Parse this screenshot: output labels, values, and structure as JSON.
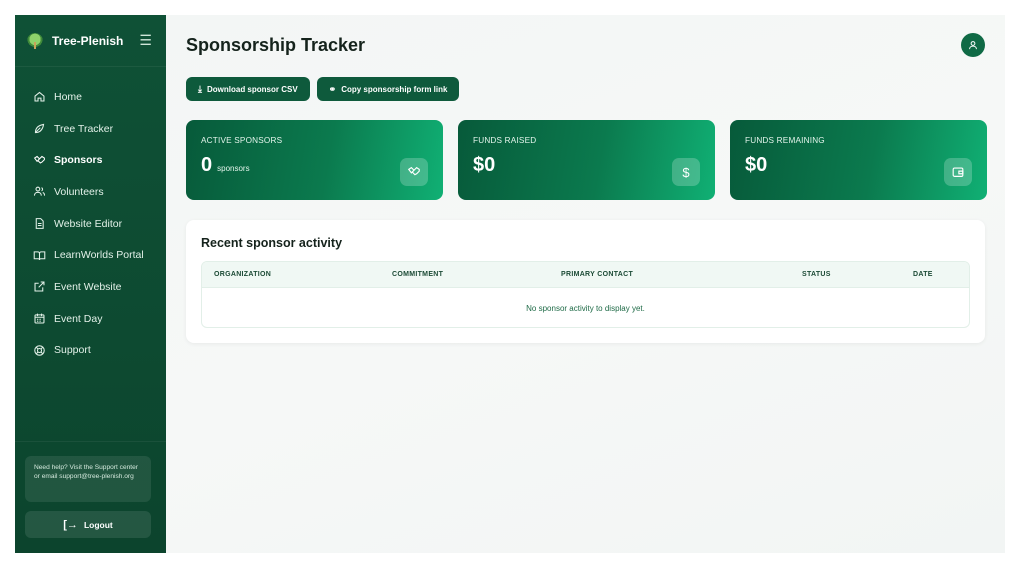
{
  "brand": {
    "name": "Tree-Plenish",
    "menu_icon": "hamburger-icon"
  },
  "sidebar": {
    "items": [
      {
        "label": "Home",
        "icon": "home-icon",
        "active": false
      },
      {
        "label": "Tree Tracker",
        "icon": "leaf-icon",
        "active": false
      },
      {
        "label": "Sponsors",
        "icon": "handshake-icon",
        "active": true
      },
      {
        "label": "Volunteers",
        "icon": "users-icon",
        "active": false
      },
      {
        "label": "Website Editor",
        "icon": "document-icon",
        "active": false
      },
      {
        "label": "LearnWorlds Portal",
        "icon": "book-icon",
        "active": false
      },
      {
        "label": "Event Website",
        "icon": "external-link-icon",
        "active": false
      },
      {
        "label": "Event Day",
        "icon": "calendar-icon",
        "active": false
      },
      {
        "label": "Support",
        "icon": "lifebuoy-icon",
        "active": false
      }
    ],
    "help_text": "Need help? Visit the Support center or email support@tree-plenish.org",
    "logout_label": "Logout"
  },
  "header": {
    "title": "Sponsorship Tracker",
    "avatar_icon": "user-icon"
  },
  "actions": {
    "download_label": "Download sponsor CSV",
    "copy_label": "Copy sponsorship form link"
  },
  "stats": [
    {
      "label": "ACTIVE SPONSORS",
      "value": "0",
      "unit": "sponsors",
      "icon": "handshake-icon"
    },
    {
      "label": "FUNDS RAISED",
      "value": "$0",
      "unit": "",
      "icon": "dollar-icon"
    },
    {
      "label": "FUNDS REMAINING",
      "value": "$0",
      "unit": "",
      "icon": "wallet-icon"
    }
  ],
  "activity": {
    "title": "Recent sponsor activity",
    "columns": [
      "ORGANIZATION",
      "COMMITMENT",
      "PRIMARY CONTACT",
      "STATUS",
      "DATE"
    ],
    "empty_message": "No sponsor activity to display yet."
  },
  "colors": {
    "sidebar": "#0f5136",
    "accent": "#0e5a3c",
    "card_gradient_end": "#10b074"
  }
}
